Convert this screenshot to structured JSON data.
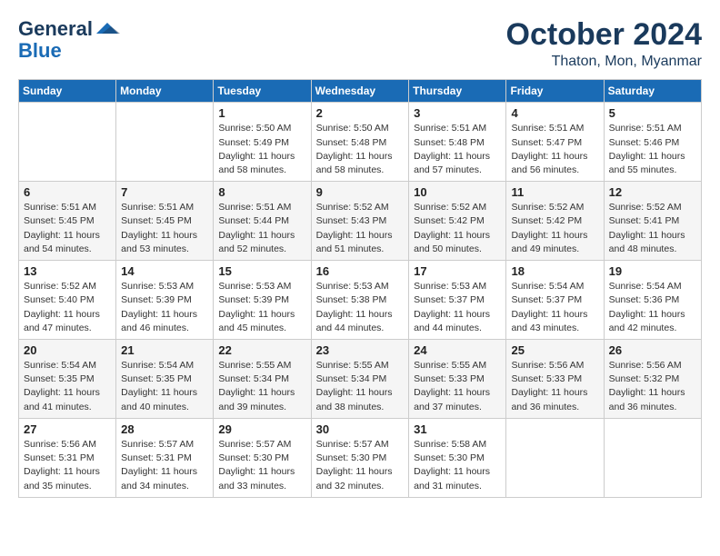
{
  "header": {
    "logo_line1": "General",
    "logo_line2": "Blue",
    "month": "October 2024",
    "location": "Thaton, Mon, Myanmar"
  },
  "columns": [
    "Sunday",
    "Monday",
    "Tuesday",
    "Wednesday",
    "Thursday",
    "Friday",
    "Saturday"
  ],
  "weeks": [
    [
      {
        "day": "",
        "info": ""
      },
      {
        "day": "",
        "info": ""
      },
      {
        "day": "1",
        "info": "Sunrise: 5:50 AM\nSunset: 5:49 PM\nDaylight: 11 hours and 58 minutes."
      },
      {
        "day": "2",
        "info": "Sunrise: 5:50 AM\nSunset: 5:48 PM\nDaylight: 11 hours and 58 minutes."
      },
      {
        "day": "3",
        "info": "Sunrise: 5:51 AM\nSunset: 5:48 PM\nDaylight: 11 hours and 57 minutes."
      },
      {
        "day": "4",
        "info": "Sunrise: 5:51 AM\nSunset: 5:47 PM\nDaylight: 11 hours and 56 minutes."
      },
      {
        "day": "5",
        "info": "Sunrise: 5:51 AM\nSunset: 5:46 PM\nDaylight: 11 hours and 55 minutes."
      }
    ],
    [
      {
        "day": "6",
        "info": "Sunrise: 5:51 AM\nSunset: 5:45 PM\nDaylight: 11 hours and 54 minutes."
      },
      {
        "day": "7",
        "info": "Sunrise: 5:51 AM\nSunset: 5:45 PM\nDaylight: 11 hours and 53 minutes."
      },
      {
        "day": "8",
        "info": "Sunrise: 5:51 AM\nSunset: 5:44 PM\nDaylight: 11 hours and 52 minutes."
      },
      {
        "day": "9",
        "info": "Sunrise: 5:52 AM\nSunset: 5:43 PM\nDaylight: 11 hours and 51 minutes."
      },
      {
        "day": "10",
        "info": "Sunrise: 5:52 AM\nSunset: 5:42 PM\nDaylight: 11 hours and 50 minutes."
      },
      {
        "day": "11",
        "info": "Sunrise: 5:52 AM\nSunset: 5:42 PM\nDaylight: 11 hours and 49 minutes."
      },
      {
        "day": "12",
        "info": "Sunrise: 5:52 AM\nSunset: 5:41 PM\nDaylight: 11 hours and 48 minutes."
      }
    ],
    [
      {
        "day": "13",
        "info": "Sunrise: 5:52 AM\nSunset: 5:40 PM\nDaylight: 11 hours and 47 minutes."
      },
      {
        "day": "14",
        "info": "Sunrise: 5:53 AM\nSunset: 5:39 PM\nDaylight: 11 hours and 46 minutes."
      },
      {
        "day": "15",
        "info": "Sunrise: 5:53 AM\nSunset: 5:39 PM\nDaylight: 11 hours and 45 minutes."
      },
      {
        "day": "16",
        "info": "Sunrise: 5:53 AM\nSunset: 5:38 PM\nDaylight: 11 hours and 44 minutes."
      },
      {
        "day": "17",
        "info": "Sunrise: 5:53 AM\nSunset: 5:37 PM\nDaylight: 11 hours and 44 minutes."
      },
      {
        "day": "18",
        "info": "Sunrise: 5:54 AM\nSunset: 5:37 PM\nDaylight: 11 hours and 43 minutes."
      },
      {
        "day": "19",
        "info": "Sunrise: 5:54 AM\nSunset: 5:36 PM\nDaylight: 11 hours and 42 minutes."
      }
    ],
    [
      {
        "day": "20",
        "info": "Sunrise: 5:54 AM\nSunset: 5:35 PM\nDaylight: 11 hours and 41 minutes."
      },
      {
        "day": "21",
        "info": "Sunrise: 5:54 AM\nSunset: 5:35 PM\nDaylight: 11 hours and 40 minutes."
      },
      {
        "day": "22",
        "info": "Sunrise: 5:55 AM\nSunset: 5:34 PM\nDaylight: 11 hours and 39 minutes."
      },
      {
        "day": "23",
        "info": "Sunrise: 5:55 AM\nSunset: 5:34 PM\nDaylight: 11 hours and 38 minutes."
      },
      {
        "day": "24",
        "info": "Sunrise: 5:55 AM\nSunset: 5:33 PM\nDaylight: 11 hours and 37 minutes."
      },
      {
        "day": "25",
        "info": "Sunrise: 5:56 AM\nSunset: 5:33 PM\nDaylight: 11 hours and 36 minutes."
      },
      {
        "day": "26",
        "info": "Sunrise: 5:56 AM\nSunset: 5:32 PM\nDaylight: 11 hours and 36 minutes."
      }
    ],
    [
      {
        "day": "27",
        "info": "Sunrise: 5:56 AM\nSunset: 5:31 PM\nDaylight: 11 hours and 35 minutes."
      },
      {
        "day": "28",
        "info": "Sunrise: 5:57 AM\nSunset: 5:31 PM\nDaylight: 11 hours and 34 minutes."
      },
      {
        "day": "29",
        "info": "Sunrise: 5:57 AM\nSunset: 5:30 PM\nDaylight: 11 hours and 33 minutes."
      },
      {
        "day": "30",
        "info": "Sunrise: 5:57 AM\nSunset: 5:30 PM\nDaylight: 11 hours and 32 minutes."
      },
      {
        "day": "31",
        "info": "Sunrise: 5:58 AM\nSunset: 5:30 PM\nDaylight: 11 hours and 31 minutes."
      },
      {
        "day": "",
        "info": ""
      },
      {
        "day": "",
        "info": ""
      }
    ]
  ]
}
